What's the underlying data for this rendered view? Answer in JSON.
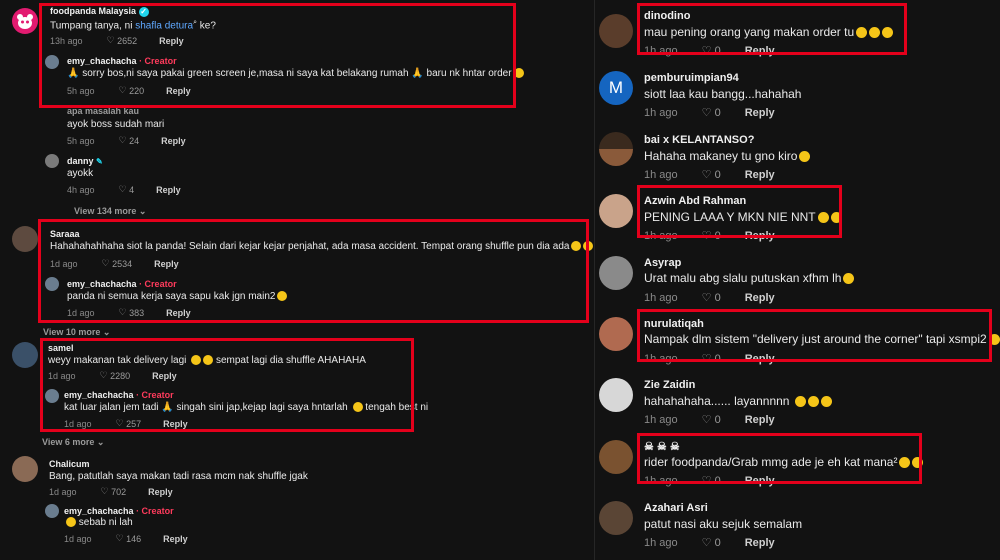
{
  "left": {
    "comments": [
      {
        "user": "foodpanda Malaysia",
        "verified": true,
        "text_before": "Tumpang tanya, ni ",
        "text_link": "shafla detura",
        "text_after": " ke?",
        "time": "13h ago",
        "likes": "2652",
        "reply": "Reply",
        "avatar_color": "#e21b70"
      },
      {
        "user": "emy_chachacha",
        "creator_tag": "· Creator",
        "text": "🙏 sorry bos,ni saya pakai green screen je,masa ni saya kat belakang rumah 🙏 baru nk hntar order",
        "time": "5h ago",
        "likes": "220",
        "reply": "Reply"
      },
      {
        "user": "apa masalah kau",
        "text": "ayok boss sudah mari",
        "time": "5h ago",
        "likes": "24",
        "reply": "Reply"
      },
      {
        "user": "danny",
        "text": "ayokk",
        "time": "4h ago",
        "likes": "4",
        "reply": "Reply"
      },
      {
        "view_more": "View 134 more"
      },
      {
        "user": "Saraaa",
        "text": "Hahahahahhaha siot la panda! Selain dari kejar kejar penjahat, ada masa accident. Tempat orang shuffle pun dia ada",
        "time": "1d ago",
        "likes": "2534",
        "reply": "Reply"
      },
      {
        "user": "emy_chachacha",
        "creator_tag": "· Creator",
        "text": "panda ni semua kerja saya sapu kak jgn main2",
        "time": "1d ago",
        "likes": "383",
        "reply": "Reply"
      },
      {
        "view_more": "View 10 more"
      },
      {
        "user": "samel",
        "text": "weyy makanan tak delivery lagi",
        "text_after": " sempat lagi dia shuffle AHAHAHA",
        "time": "1d ago",
        "likes": "2280",
        "reply": "Reply"
      },
      {
        "user": "emy_chachacha",
        "creator_tag": "· Creator",
        "text": "kat luar jalan jem tadi 🙏 singah sini jap,kejap lagi saya hntarlah",
        "text_after": " tengah best ni",
        "time": "1d ago",
        "likes": "257",
        "reply": "Reply"
      },
      {
        "view_more": "View 6 more"
      },
      {
        "user": "Chalicum",
        "text": "Bang, patutlah saya makan tadi rasa mcm nak shuffle jgak",
        "time": "1d ago",
        "likes": "702",
        "reply": "Reply"
      },
      {
        "user": "emy_chachacha",
        "creator_tag": "· Creator",
        "text": " sebab ni lah",
        "time": "1d ago",
        "likes": "146",
        "reply": "Reply"
      }
    ]
  },
  "right": {
    "comments": [
      {
        "user": "dinodino",
        "text": "mau pening orang yang makan order tu",
        "time": "1h ago",
        "likes": "0",
        "reply": "Reply",
        "avatar_color": "#5a3d2b"
      },
      {
        "user": "pemburuimpian94",
        "text": "siott laa kau bangg...hahahah",
        "time": "1h ago",
        "likes": "0",
        "reply": "Reply",
        "avatar_letter": "M",
        "avatar_color": "#1565c0"
      },
      {
        "user": "bai x KELANTANSO?",
        "text": "Hahaha makaney tu gno kiro",
        "time": "1h ago",
        "likes": "0",
        "reply": "Reply",
        "avatar_color": "#6b4a2a"
      },
      {
        "user": "Azwin Abd Rahman",
        "text": "PENING LAAA Y MKN NIE NNT",
        "time": "1h ago",
        "likes": "0",
        "reply": "Reply",
        "avatar_color": "#c9a38a"
      },
      {
        "user": "Asyrap",
        "text": "Urat malu abg slalu putuskan xfhm lh",
        "time": "1h ago",
        "likes": "0",
        "reply": "Reply",
        "avatar_color": "#8a8a8a"
      },
      {
        "user": "nurulatiqah",
        "text": "Nampak dlm sistem \"delivery just around the corner\" tapi xsmpi2",
        "time": "1h ago",
        "likes": "0",
        "reply": "Reply",
        "avatar_color": "#b06a50"
      },
      {
        "user": "Zie Zaidin",
        "text": "hahahahaha...... layannnnn",
        "time": "1h ago",
        "likes": "0",
        "reply": "Reply",
        "avatar_color": "#d7d7d7"
      },
      {
        "user": "☠ ☠ ☠",
        "text": "rider foodpanda/Grab mmg ade je eh kat mana²",
        "time": "1h ago",
        "likes": "0",
        "reply": "Reply",
        "avatar_color": "#7a5230"
      },
      {
        "user": "Azahari Asri",
        "text": "patut nasi aku sejuk semalam",
        "time": "1h ago",
        "likes": "0",
        "reply": "Reply",
        "avatar_color": "#5a4535"
      }
    ]
  }
}
